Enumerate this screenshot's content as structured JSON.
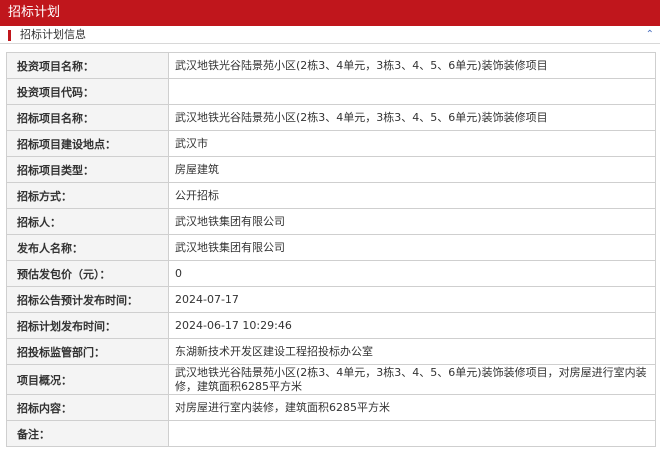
{
  "header": {
    "title": "招标计划"
  },
  "section": {
    "title": "招标计划信息",
    "collapse_icon": "chevron-up-icon"
  },
  "rows": [
    {
      "label": "投资项目名称：",
      "value": "武汉地铁光谷陆景苑小区(2栋3、4单元，3栋3、4、5、6单元)装饰装修项目"
    },
    {
      "label": "投资项目代码：",
      "value": ""
    },
    {
      "label": "招标项目名称：",
      "value": "武汉地铁光谷陆景苑小区(2栋3、4单元，3栋3、4、5、6单元)装饰装修项目"
    },
    {
      "label": "招标项目建设地点：",
      "value": "武汉市"
    },
    {
      "label": "招标项目类型：",
      "value": "房屋建筑"
    },
    {
      "label": "招标方式：",
      "value": "公开招标"
    },
    {
      "label": "招标人：",
      "value": "武汉地铁集团有限公司"
    },
    {
      "label": "发布人名称：",
      "value": "武汉地铁集团有限公司"
    },
    {
      "label": "预估发包价（元）：",
      "value": "0"
    },
    {
      "label": "招标公告预计发布时间：",
      "value": "2024-07-17"
    },
    {
      "label": "招标计划发布时间：",
      "value": "2024-06-17 10:29:46"
    },
    {
      "label": "招投标监管部门：",
      "value": "东湖新技术开发区建设工程招投标办公室"
    },
    {
      "label": "项目概况：",
      "value": "武汉地铁光谷陆景苑小区(2栋3、4单元，3栋3、4、5、6单元)装饰装修项目，对房屋进行室内装修，建筑面积6285平方米"
    },
    {
      "label": "招标内容：",
      "value": "对房屋进行室内装修，建筑面积6285平方米"
    },
    {
      "label": "备注：",
      "value": ""
    }
  ]
}
